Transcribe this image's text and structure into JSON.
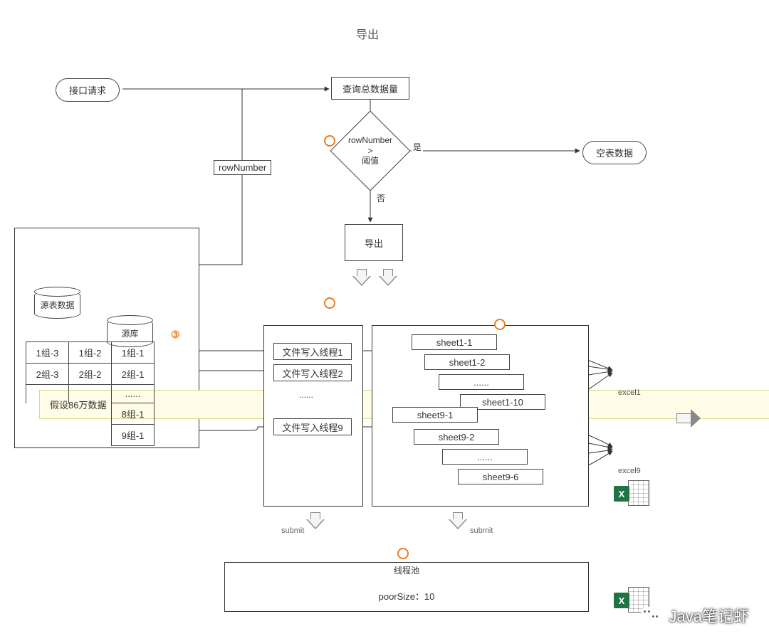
{
  "title": "导出",
  "start": "接口请求",
  "queryTotal": "查询总数据量",
  "diamond": "rowNumber\n>\n阈值",
  "diamondYes": "是",
  "diamondNo": "否",
  "empty": "空表数据",
  "rowNumberLabel": "rowNumber",
  "exportBox": "导出",
  "sourceTable": "源表数据",
  "sourceDb": "源库",
  "assumption": "假设86万数据",
  "circ3": "③",
  "groups": {
    "r1": [
      "1组-3",
      "1组-2",
      "1组-1"
    ],
    "r2": [
      "2组-3",
      "2组-2",
      "2组-1"
    ],
    "r3": [
      "",
      "",
      "......"
    ],
    "r4": [
      "",
      "",
      "8组-1"
    ],
    "r5": [
      "",
      "",
      "9组-1"
    ]
  },
  "threads": {
    "t1": "文件写入线程1",
    "t2": "文件写入线程2",
    "tdots": "......",
    "t9": "文件写入线程9"
  },
  "sheetsA": {
    "s1": "sheet1-1",
    "s2": "sheet1-2",
    "sd": "......",
    "s10": "sheet1-10"
  },
  "sheetsB": {
    "s1": "sheet9-1",
    "s2": "sheet9-2",
    "sd": "......",
    "s6": "sheet9-6"
  },
  "excel1": "excel1",
  "excel9": "excel9",
  "submit": "submit",
  "poolTitle": "线程池",
  "poolSize": "poorSize：10",
  "watermark": "Java笔记虾"
}
